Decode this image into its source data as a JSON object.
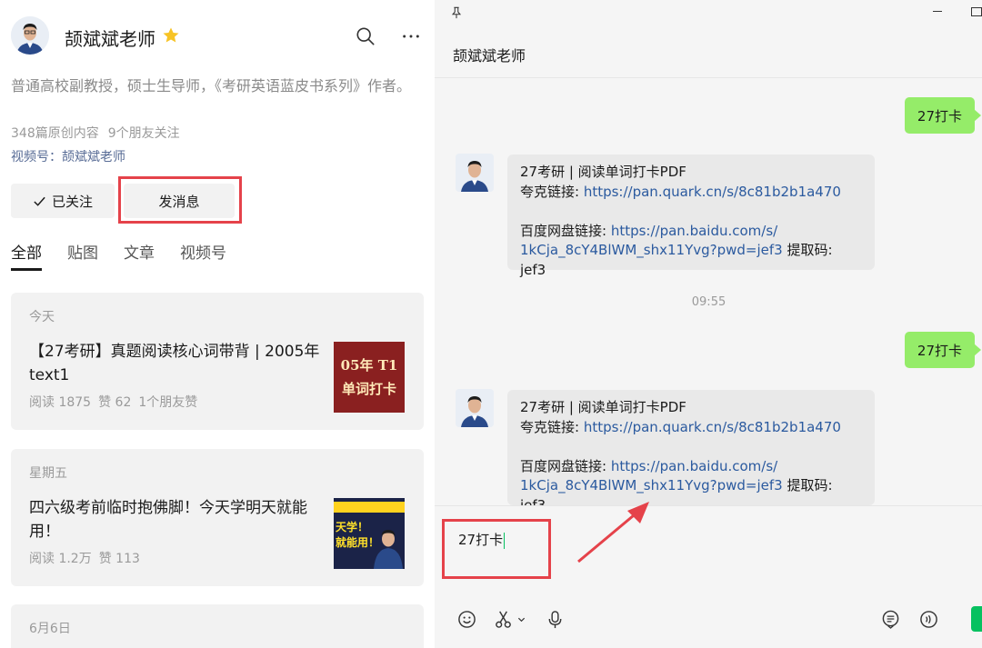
{
  "profile": {
    "name": "颉斌斌老师",
    "bio": "普通高校副教授，硕士生导师，《考研英语蓝皮书系列》作者。",
    "original_count": "348篇原创内容",
    "friends_follow": "9个朋友关注",
    "channel": "视频号：颉斌斌老师",
    "followed_label": "已关注",
    "message_label": "发消息",
    "icons": [
      "star-icon",
      "search-icon",
      "more-icon",
      "check-icon"
    ]
  },
  "tabs": [
    {
      "label": "全部",
      "active": true
    },
    {
      "label": "贴图"
    },
    {
      "label": "文章"
    },
    {
      "label": "视频号"
    }
  ],
  "articles": [
    {
      "date": "今天",
      "title": "【27考研】真题阅读核心词带背 | 2005年text1",
      "reads": "阅读 1875",
      "likes": "赞 62",
      "friends": "1个朋友赞",
      "thumb_line1": "05年 T1",
      "thumb_line2": "单词打卡"
    },
    {
      "date": "星期五",
      "title": "四六级考前临时抱佛脚！今天学明天就能用！",
      "reads": "阅读 1.2万",
      "likes": "赞 113",
      "thumb_line1": "天学！",
      "thumb_line2": "就能用！"
    },
    {
      "date": "6月6日"
    }
  ],
  "chat": {
    "title": "颉斌斌老师",
    "timestamp": "09:55",
    "my_message": "27打卡",
    "reply": {
      "line1": "27考研 | 阅读单词打卡PDF",
      "quark_label": "夸克链接: ",
      "quark_link": "https://pan.quark.cn/s/8c81b2b1a470",
      "baidu_label": "百度网盘链接: ",
      "baidu_link_part1": "https://pan.baidu.com/s/",
      "baidu_link_part2": "1kCja_8cY4BlWM_shx11Yvg?pwd=jef3",
      "code_label": " 提取码: jef3"
    },
    "input_value": "27打卡",
    "icons": [
      "pin-icon",
      "emoji-icon",
      "scissors-icon",
      "microphone-icon",
      "chat-history-icon",
      "voice-call-icon"
    ]
  },
  "colors": {
    "my_bubble": "#95ec69",
    "link": "#2b5a9f",
    "highlight": "#e5424a",
    "send_green": "#07c160"
  }
}
